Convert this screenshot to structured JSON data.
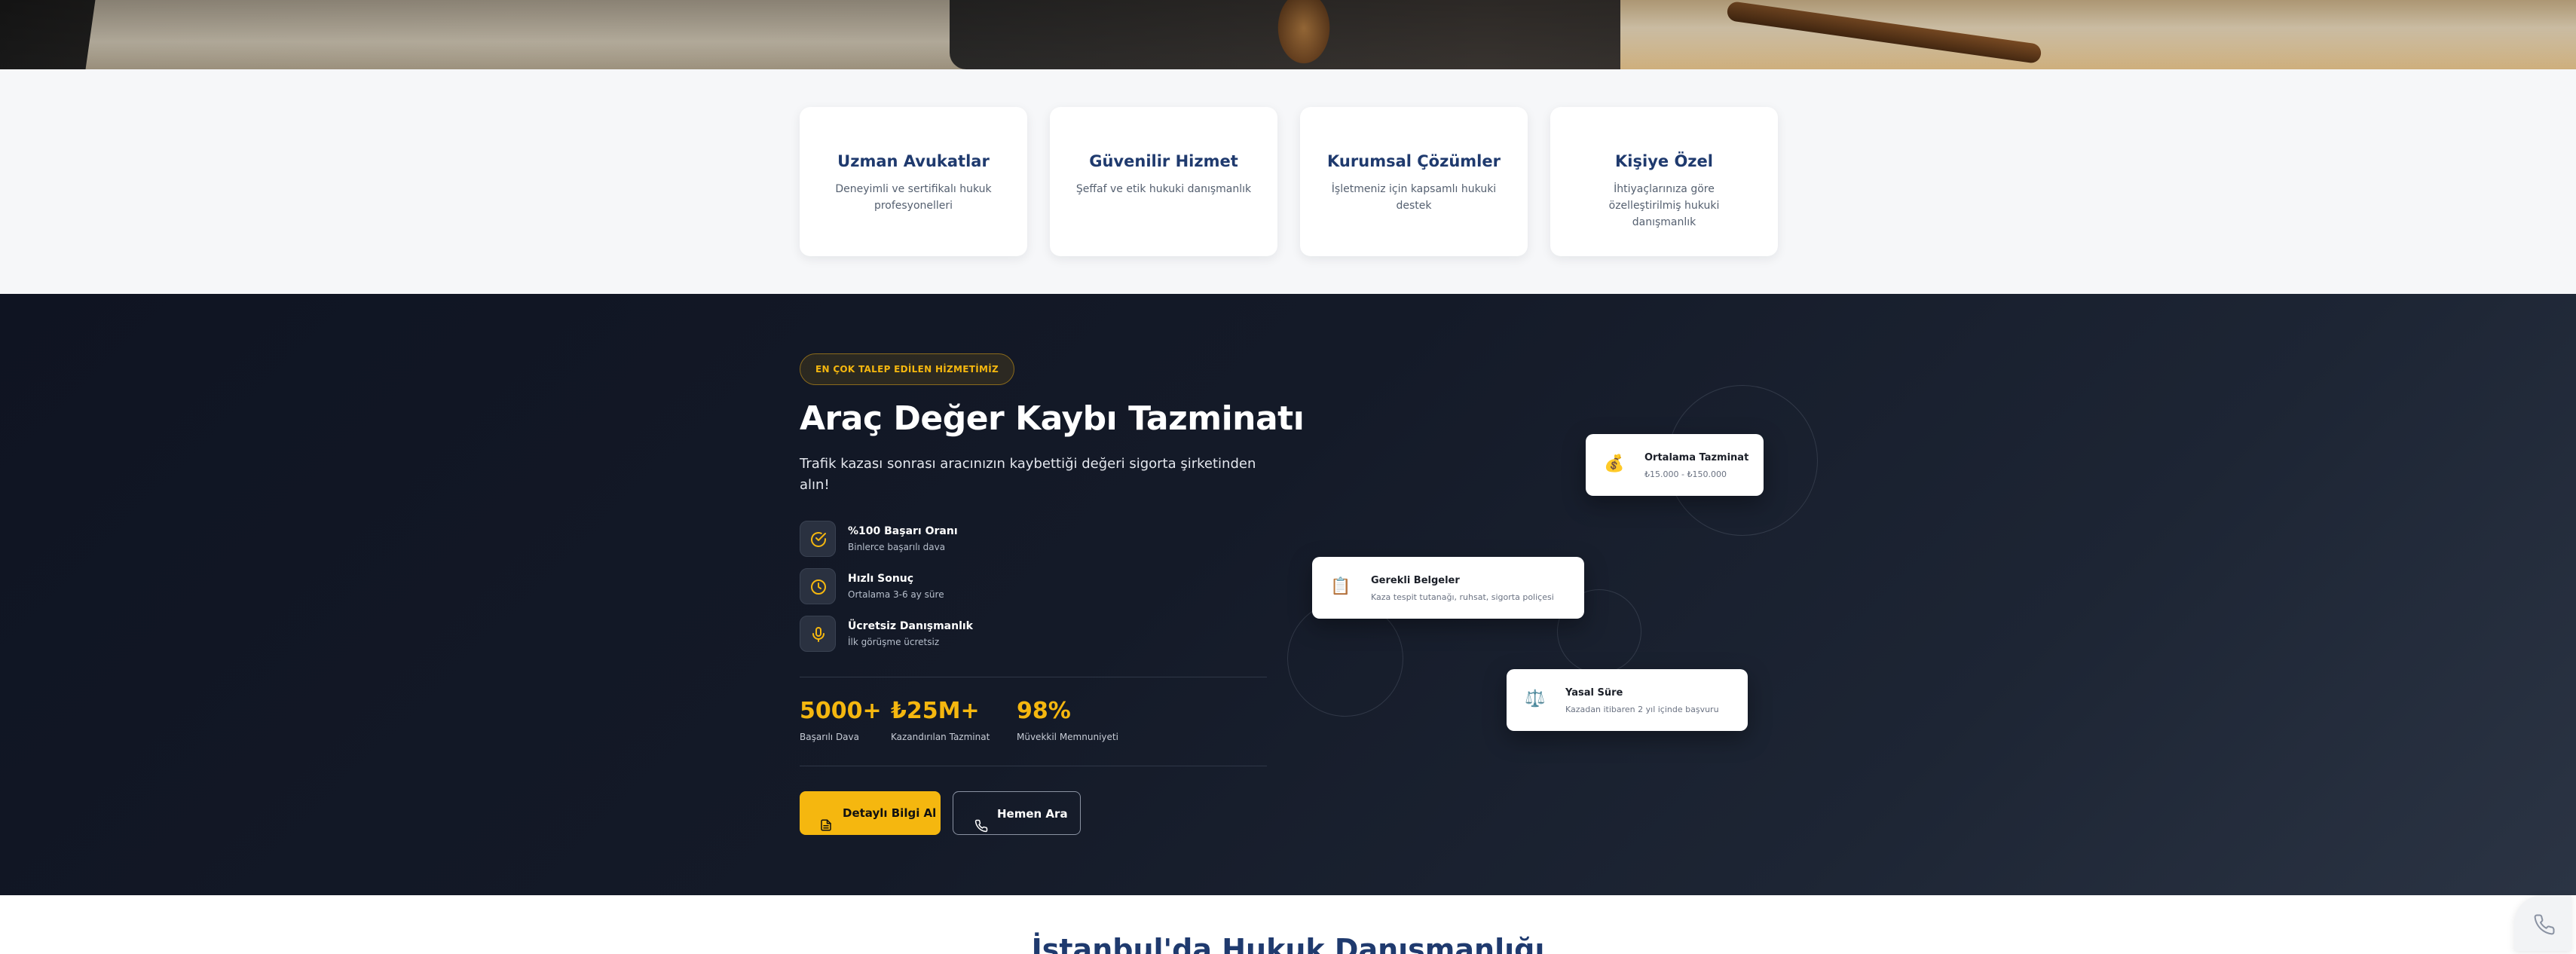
{
  "features": [
    {
      "title": "Uzman Avukatlar",
      "desc": "Deneyimli ve sertifikalı hukuk profesyonelleri"
    },
    {
      "title": "Güvenilir Hizmet",
      "desc": "Şeffaf ve etik hukuki danışmanlık"
    },
    {
      "title": "Kurumsal Çözümler",
      "desc": "İşletmeniz için kapsamlı hukuki destek"
    },
    {
      "title": "Kişiye Özel",
      "desc": "İhtiyaçlarınıza göre özelleştirilmiş hukuki danışmanlık"
    }
  ],
  "service": {
    "badge": "EN ÇOK TALEP EDİLEN HİZMETİMİZ",
    "title": "Araç Değer Kaybı Tazminatı",
    "subtitle": "Trafik kazası sonrası aracınızın kaybettiği değeri sigorta şirketinden alın!",
    "benefits": [
      {
        "title": "%100 Başarı Oranı",
        "sub": "Binlerce başarılı dava",
        "icon": "check-circle-icon"
      },
      {
        "title": "Hızlı Sonuç",
        "sub": "Ortalama 3-6 ay süre",
        "icon": "clock-icon"
      },
      {
        "title": "Ücretsiz Danışmanlık",
        "sub": "İlk görüşme ücretsiz",
        "icon": "microphone-icon"
      }
    ],
    "stats": [
      {
        "value": "5000+",
        "label": "Başarılı Dava"
      },
      {
        "value": "₺25M+",
        "label": "Kazandırılan Tazminat"
      },
      {
        "value": "98%",
        "label": "Müvekkil Memnuniyeti"
      }
    ],
    "primary_button": "Detaylı Bilgi Al",
    "secondary_button": "Hemen Ara",
    "cards": [
      {
        "title": "Ortalama Tazminat",
        "sub": "₺15.000 - ₺150.000",
        "icon": "money-bag-icon",
        "glyph": "💰"
      },
      {
        "title": "Gerekli Belgeler",
        "sub": "Kaza tespit tutanağı, ruhsat, sigorta poliçesi",
        "icon": "clipboard-icon",
        "glyph": "📋"
      },
      {
        "title": "Yasal Süre",
        "sub": "Kazadan itibaren 2 yıl içinde başvuru",
        "icon": "scales-icon",
        "glyph": "⚖️"
      }
    ]
  },
  "bottom": {
    "title": "İstanbul'da Hukuk Danışmanlığı"
  },
  "colors": {
    "accent": "#f5b70f",
    "navy": "#1f3a6e",
    "dark_bg": "#141a28"
  }
}
